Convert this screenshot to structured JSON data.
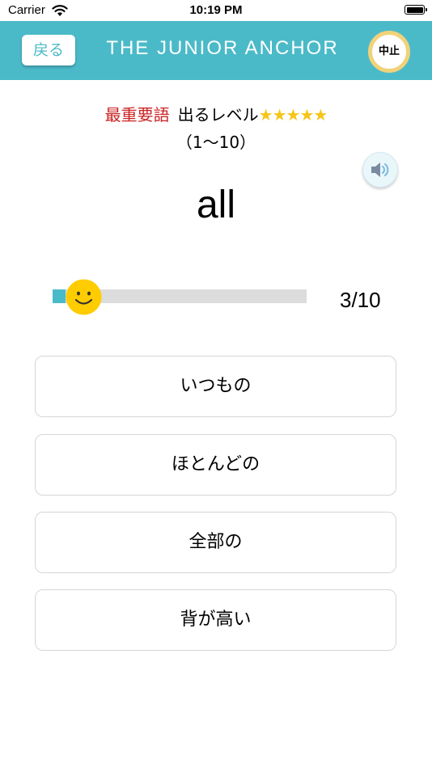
{
  "status_bar": {
    "carrier": "Carrier",
    "time": "10:19 PM"
  },
  "header": {
    "back_label": "戻る",
    "title": "THE JUNIOR ANCHOR",
    "quit_label": "中止"
  },
  "word_info": {
    "importance": "最重要語",
    "level_label": "出るレベル",
    "stars": "★★★★★",
    "star_rating": 5,
    "range": "（1〜10）"
  },
  "question": {
    "word": "all"
  },
  "progress": {
    "count_text": "3/10",
    "value": 0.05
  },
  "answers": [
    {
      "label": "いつもの"
    },
    {
      "label": "ほとんどの"
    },
    {
      "label": "全部の"
    },
    {
      "label": "背が高い"
    }
  ],
  "colors": {
    "accent": "#4bbac8",
    "importance": "#cc2222",
    "star": "#f5c518",
    "quit_ring": "#f1d27a",
    "face": "#ffcc00"
  },
  "icons": {
    "speaker": "speaker-icon",
    "face": "smiley-face-icon",
    "wifi": "wifi-icon",
    "battery": "battery-icon"
  }
}
